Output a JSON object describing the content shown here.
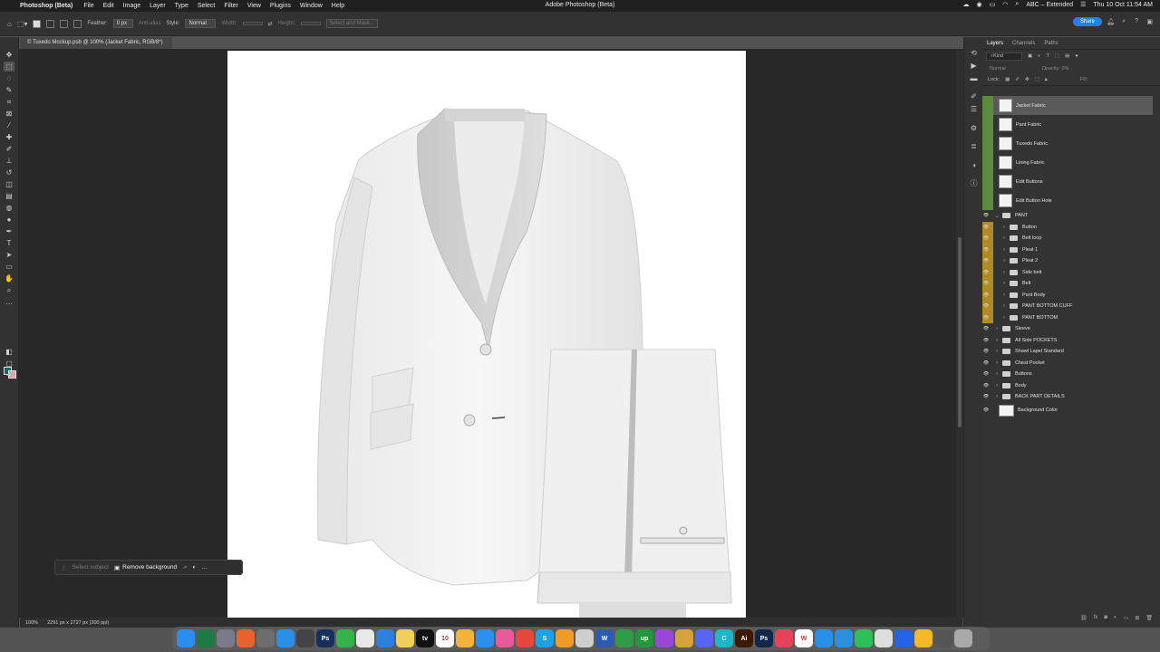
{
  "menubar": {
    "app": "Photoshop (Beta)",
    "items": [
      "File",
      "Edit",
      "Image",
      "Layer",
      "Type",
      "Select",
      "Filter",
      "View",
      "Plugins",
      "Window",
      "Help"
    ],
    "window_title": "Adobe Photoshop (Beta)",
    "input_source": "ABC – Extended",
    "datetime": "Thu 10 Oct  11:54 AM"
  },
  "options": {
    "feather_label": "Feather:",
    "feather_value": "0 px",
    "antialias": "Anti-alias",
    "style_label": "Style:",
    "style_value": "Normal",
    "width_label": "Width:",
    "height_label": "Height:",
    "select_mask": "Select and Mask...",
    "share": "Share"
  },
  "document": {
    "tab_title": "© Tuxedo Mockup.psb @ 100% (Jacket Fabric, RGB/8*)",
    "zoom": "100%",
    "doc_info": "2291 px x 2727 px (300 ppi)"
  },
  "context_bar": {
    "select_subject": "Select subject",
    "remove_bg": "Remove background"
  },
  "panel": {
    "tabs": [
      "Layers",
      "Channels",
      "Paths"
    ],
    "kind": "Kind",
    "blend": "Normal",
    "opacity": "Opacity:",
    "opacity_val": "0%",
    "lock": "Lock:",
    "fill": "Fill:"
  },
  "layers": [
    {
      "name": "Jacket Fabric",
      "type": "smart",
      "visible": false,
      "color": "green",
      "selected": true
    },
    {
      "name": "Pant Fabric",
      "type": "smart",
      "visible": false,
      "color": "green"
    },
    {
      "name": "Tuxedo Fabric",
      "type": "smart",
      "visible": false,
      "color": "green"
    },
    {
      "name": "Lining Fabric",
      "type": "smart",
      "visible": false,
      "color": "green"
    },
    {
      "name": "Edit Buttons",
      "type": "smart",
      "visible": false,
      "color": "green"
    },
    {
      "name": "Edit Button Hole",
      "type": "smart",
      "visible": false,
      "color": "green"
    },
    {
      "name": "PANT",
      "type": "group-open",
      "visible": true,
      "color": "none"
    },
    {
      "name": "Button",
      "type": "group",
      "visible": true,
      "color": "yellow",
      "indent": 1
    },
    {
      "name": "Belt loop",
      "type": "group",
      "visible": true,
      "color": "yellow",
      "indent": 1
    },
    {
      "name": "Pleat 1",
      "type": "group",
      "visible": true,
      "color": "yellow",
      "indent": 1
    },
    {
      "name": "Pleat 2",
      "type": "group",
      "visible": true,
      "color": "yellow",
      "indent": 1
    },
    {
      "name": "Side belt",
      "type": "group",
      "visible": true,
      "color": "yellow",
      "indent": 1
    },
    {
      "name": "Belt",
      "type": "group",
      "visible": true,
      "color": "yellow",
      "indent": 1
    },
    {
      "name": "Pant Body",
      "type": "group",
      "visible": true,
      "color": "yellow",
      "indent": 1
    },
    {
      "name": "PANT BOTTOM CUFF",
      "type": "group",
      "visible": true,
      "color": "yellow",
      "indent": 1
    },
    {
      "name": "PANT BOTTOM",
      "type": "group",
      "visible": true,
      "color": "yellow",
      "indent": 1
    },
    {
      "name": "Sleeve",
      "type": "group",
      "visible": true,
      "color": "none"
    },
    {
      "name": "All Side POCKETS",
      "type": "group",
      "visible": true,
      "color": "none"
    },
    {
      "name": "Shawl Lapel Standard",
      "type": "group",
      "visible": true,
      "color": "none"
    },
    {
      "name": "Chest Pocket",
      "type": "group",
      "visible": true,
      "color": "none"
    },
    {
      "name": "Buttons",
      "type": "group",
      "visible": true,
      "color": "none"
    },
    {
      "name": "Body",
      "type": "group",
      "visible": true,
      "color": "none"
    },
    {
      "name": "BACK PART DETAILS",
      "type": "group",
      "visible": true,
      "color": "none"
    },
    {
      "name": "Background Color",
      "type": "fill",
      "visible": true,
      "color": "none"
    }
  ],
  "dock": [
    {
      "name": "Finder",
      "color": "#2d8cf0"
    },
    {
      "name": "Excel",
      "color": "#1d7a45"
    },
    {
      "name": "Launchpad",
      "color": "#7a7a8a"
    },
    {
      "name": "Firefox",
      "color": "#e8632b"
    },
    {
      "name": "Settings",
      "color": "#6d6d6d"
    },
    {
      "name": "Safari",
      "color": "#2a8fe6"
    },
    {
      "name": "Calculator",
      "color": "#444"
    },
    {
      "name": "Photoshop",
      "color": "#16305c",
      "label": "Ps"
    },
    {
      "name": "FaceTime",
      "color": "#33b34a"
    },
    {
      "name": "Reminders",
      "color": "#e8e8e8"
    },
    {
      "name": "Mail",
      "color": "#2f7fe0"
    },
    {
      "name": "Notes",
      "color": "#f1d05a"
    },
    {
      "name": "Apple TV",
      "color": "#111",
      "label": "tv"
    },
    {
      "name": "Calendar",
      "color": "#fff",
      "label": "10"
    },
    {
      "name": "Photos",
      "color": "#f4b43c"
    },
    {
      "name": "App Store",
      "color": "#2a8ff0"
    },
    {
      "name": "Screens",
      "color": "#e85a9a"
    },
    {
      "name": "Chrome",
      "color": "#e4483a"
    },
    {
      "name": "Skype",
      "color": "#1fa1e6",
      "label": "S"
    },
    {
      "name": "Pages",
      "color": "#f29a26"
    },
    {
      "name": "Preview",
      "color": "#cfcfcf"
    },
    {
      "name": "Word",
      "color": "#2a5bb0",
      "label": "W"
    },
    {
      "name": "Numbers",
      "color": "#2f9d46"
    },
    {
      "name": "Upwork",
      "color": "#1f9a3a",
      "label": "up"
    },
    {
      "name": "Podcasts",
      "color": "#9a46d6"
    },
    {
      "name": "Chrome Canary",
      "color": "#d6a23a"
    },
    {
      "name": "Discord",
      "color": "#5865f2"
    },
    {
      "name": "Canva",
      "color": "#1fb5c8",
      "label": "C"
    },
    {
      "name": "Illustrator",
      "color": "#3a1a05",
      "label": "Ai"
    },
    {
      "name": "Photoshop 2",
      "color": "#0f2748",
      "label": "Ps"
    },
    {
      "name": "Music",
      "color": "#e8425a"
    },
    {
      "name": "Wise",
      "color": "#fff",
      "label": "W"
    },
    {
      "name": "Safari 2",
      "color": "#2a8fe6"
    },
    {
      "name": "Xcode",
      "color": "#2b8fe0"
    },
    {
      "name": "WhatsApp",
      "color": "#2fbf58"
    },
    {
      "name": "Pencil",
      "color": "#ddd"
    },
    {
      "name": "Dropbox",
      "color": "#2462e6"
    },
    {
      "name": "Keep",
      "color": "#f4b928"
    },
    {
      "name": "Screenshot",
      "color": "#555"
    },
    {
      "name": "Trash",
      "color": "#a9a9a9"
    }
  ]
}
